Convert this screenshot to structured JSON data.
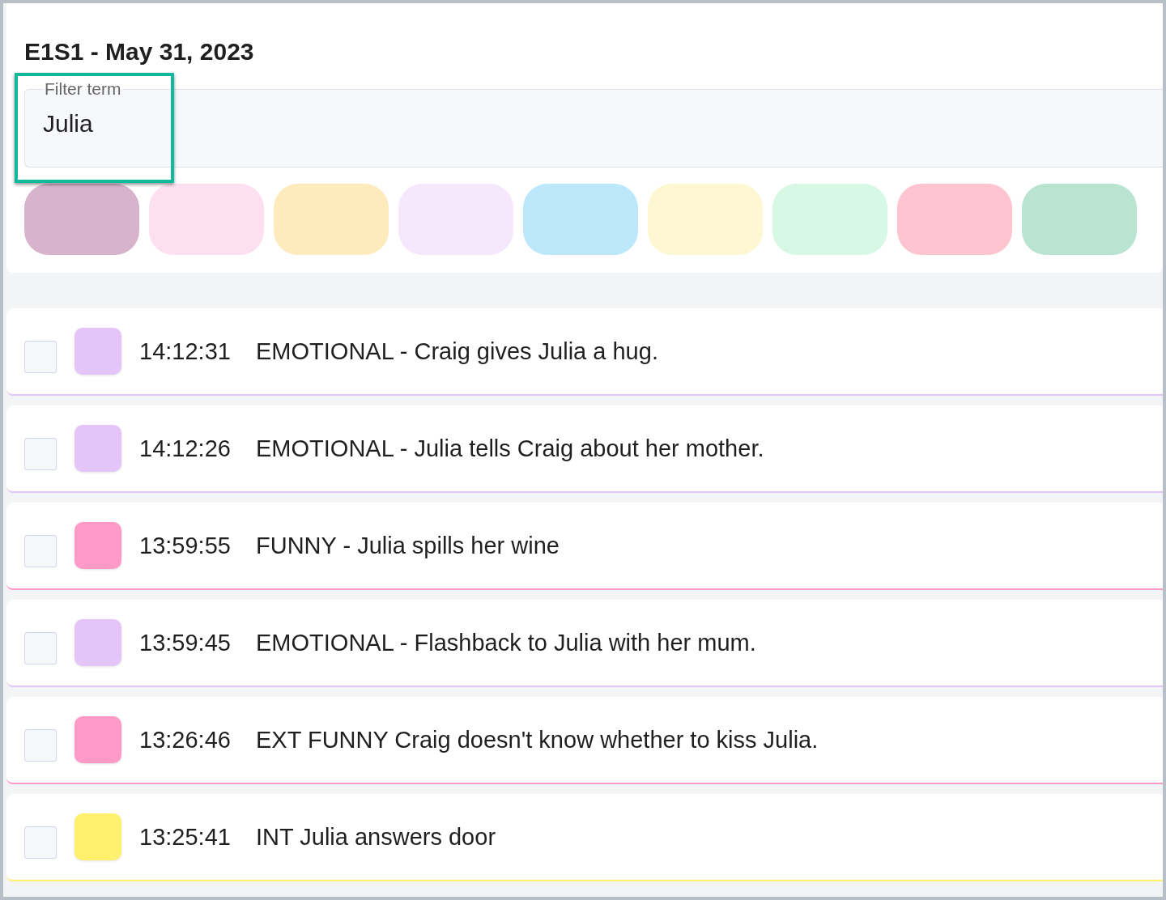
{
  "title": "E1S1 - May 31, 2023",
  "filter": {
    "label": "Filter term",
    "value": "Julia"
  },
  "color_chips": [
    {
      "color": "#d8b4cc"
    },
    {
      "color": "#fde0ef"
    },
    {
      "color": "#feebbd"
    },
    {
      "color": "#f5e8fc"
    },
    {
      "color": "#bde8fb"
    },
    {
      "color": "#fef8d2"
    },
    {
      "color": "#d6f8e4"
    },
    {
      "color": "#fec4d0"
    },
    {
      "color": "#b9e4d2"
    }
  ],
  "rows": [
    {
      "checked": false,
      "color": "#e5c4fa",
      "time": "14:12:31",
      "text": "EMOTIONAL - Craig gives Julia a hug."
    },
    {
      "checked": false,
      "color": "#e5c4fa",
      "time": "14:12:26",
      "text": "EMOTIONAL - Julia tells Craig about her mother."
    },
    {
      "checked": false,
      "color": "#ff9ac8",
      "time": "13:59:55",
      "text": "FUNNY - Julia spills her wine"
    },
    {
      "checked": false,
      "color": "#e5c4fa",
      "time": "13:59:45",
      "text": "EMOTIONAL - Flashback to Julia with her mum."
    },
    {
      "checked": false,
      "color": "#ff9ac8",
      "time": "13:26:46",
      "text": "EXT FUNNY Craig doesn't know whether to kiss Julia."
    },
    {
      "checked": false,
      "color": "#fff06e",
      "time": "13:25:41",
      "text": "INT Julia answers door"
    }
  ]
}
